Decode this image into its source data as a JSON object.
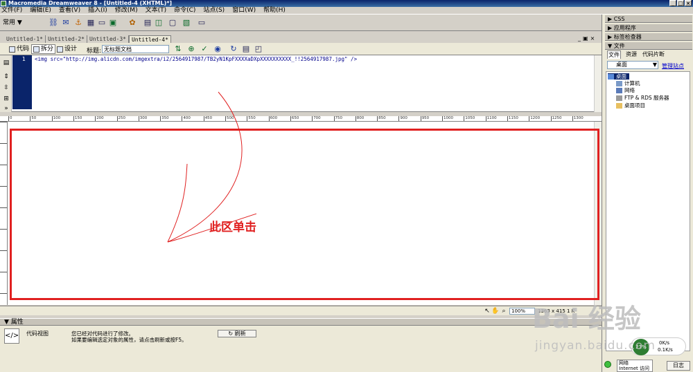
{
  "window": {
    "title": "Macromedia Dreamweaver 8 - [Untitled-4 (XHTML)*]",
    "controls": [
      "_",
      "□",
      "×"
    ]
  },
  "menu": [
    "文件(F)",
    "编辑(E)",
    "查看(V)",
    "插入(I)",
    "修改(M)",
    "文本(T)",
    "命令(C)",
    "站点(S)",
    "窗口(W)",
    "帮助(H)"
  ],
  "insert_bar": {
    "category": "常用 ▼"
  },
  "doc_tabs": [
    "Untitled-1*",
    "Untitled-2*",
    "Untitled-3*",
    "Untitled-4*"
  ],
  "doc_toolbar": {
    "code": "代码",
    "split": "拆分",
    "design": "设计",
    "title_label": "标题:",
    "title_value": "无标题文档"
  },
  "code": {
    "line_number": "1",
    "line": "<img src=\"http://img.alicdn.com/imgextra/i2/2564917987/TB2yN1KpFXXXXaDXpXXXXXXXXXX_!!2564917987.jpg\" />"
  },
  "ruler": [
    "0",
    "50",
    "100",
    "150",
    "200",
    "250",
    "300",
    "350",
    "400",
    "450",
    "500",
    "550",
    "600",
    "650",
    "700",
    "750",
    "800",
    "850",
    "900",
    "950",
    "1000",
    "1050",
    "1100",
    "1150",
    "1200",
    "1250",
    "1300"
  ],
  "annotation": "此区单击",
  "status": {
    "zoom": "100%",
    "size": "1363 x 415",
    "page": "1 K"
  },
  "properties": {
    "header": "▼ 属性",
    "label": "代码视图",
    "msg1": "您已经对代码进行了修改。",
    "msg2": "如果要编辑选定对象的属性，请点击刷新或按F5。",
    "refresh": "刷新"
  },
  "right_panel": {
    "panels": [
      "▶ CSS",
      "▶ 应用程序",
      "▶ 标签检查器",
      "▼ 文件"
    ],
    "file_tabs": [
      "文件",
      "资源",
      "代码片断"
    ],
    "site": "桌面",
    "manage": "管理站点",
    "tree": [
      "桌面",
      "计算机",
      "网络",
      "FTP & RDS 服务器",
      "桌面项目"
    ],
    "log": "日志"
  },
  "taskbar": {
    "popup_line1": "网络",
    "popup_line2": "Internet 访问",
    "net_percent": "21%",
    "net_up": "0K/s",
    "net_down": "0.1K/s"
  },
  "watermark": {
    "logo": "Bai 经验",
    "sub": "jingyan.baidu.com"
  },
  "colors": {
    "titlebar": "#0a246a",
    "highlight": "#e02020",
    "gutter": "#0a246a"
  }
}
